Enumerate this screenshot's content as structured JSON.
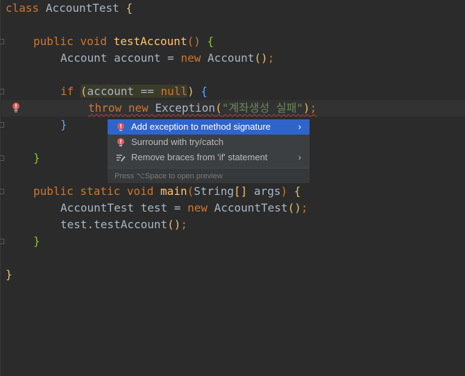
{
  "code": {
    "class_kw": "class",
    "class_name": "AccountTest",
    "brace_open": "{",
    "brace_close": "}",
    "public_kw": "public",
    "void_kw": "void",
    "static_kw": "static",
    "if_kw": "if",
    "new_kw": "new",
    "throw_kw": "throw",
    "null_kw": "null",
    "test_method": "testAccount",
    "main_method": "main",
    "parens": "()",
    "account_type": "Account",
    "account_var": "account",
    "equals": "=",
    "eqeq": "==",
    "exception_type": "Exception",
    "exception_msg": "\"계좌생성 실패\"",
    "semicolon": ";",
    "string_type": "String",
    "array_brackets": "[]",
    "args": "args",
    "test_type": "AccountTest",
    "test_var": "test",
    "call_expr": "test.testAccount"
  },
  "popup": {
    "items": [
      {
        "label": "Add exception to method signature",
        "chevron": "›"
      },
      {
        "label": "Surround with try/catch"
      },
      {
        "label": "Remove braces from 'if' statement",
        "chevron": "›"
      }
    ],
    "footer": "Press ⌥Space to open preview"
  },
  "colors": {
    "background": "#2b2b2b",
    "keyword": "#cc7832",
    "method": "#ffc66d",
    "string": "#6a8759",
    "text": "#a9b7c6",
    "popup_bg": "#3c3f41",
    "selection": "#2f65ca",
    "error": "#db5c5c"
  },
  "icons": {
    "gutter": "lightbulb-error-icon",
    "item0": "error-bulb-icon",
    "item1": "error-bulb-icon",
    "item2": "edit-braces-icon"
  }
}
